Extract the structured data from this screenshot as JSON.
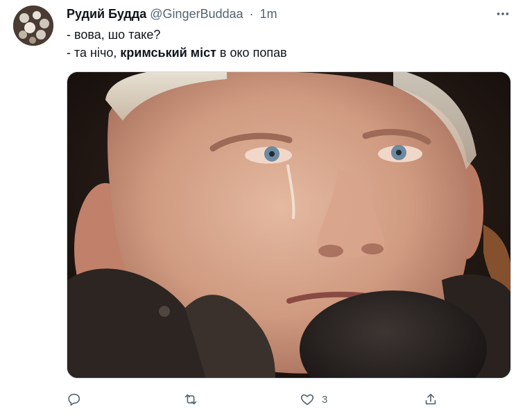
{
  "tweet": {
    "author": {
      "display_name": "Рудий Будда",
      "handle": "@GingerBuddaa",
      "separator": "·",
      "time": "1m"
    },
    "lines": [
      {
        "text": "- вова, шо таке?"
      },
      {
        "prefix": "- та нічо, ",
        "bold": "кримський міст",
        "suffix": " в око попав"
      }
    ],
    "actions": {
      "reply": {
        "icon": "reply-icon",
        "count": ""
      },
      "retweet": {
        "icon": "retweet-icon",
        "count": ""
      },
      "like": {
        "icon": "heart-icon",
        "count": "3"
      },
      "share": {
        "icon": "share-icon",
        "count": ""
      }
    },
    "more": {
      "icon": "more-icon"
    }
  },
  "colors": {
    "text": "#0f1419",
    "muted": "#536471",
    "border": "#cfd9de"
  }
}
